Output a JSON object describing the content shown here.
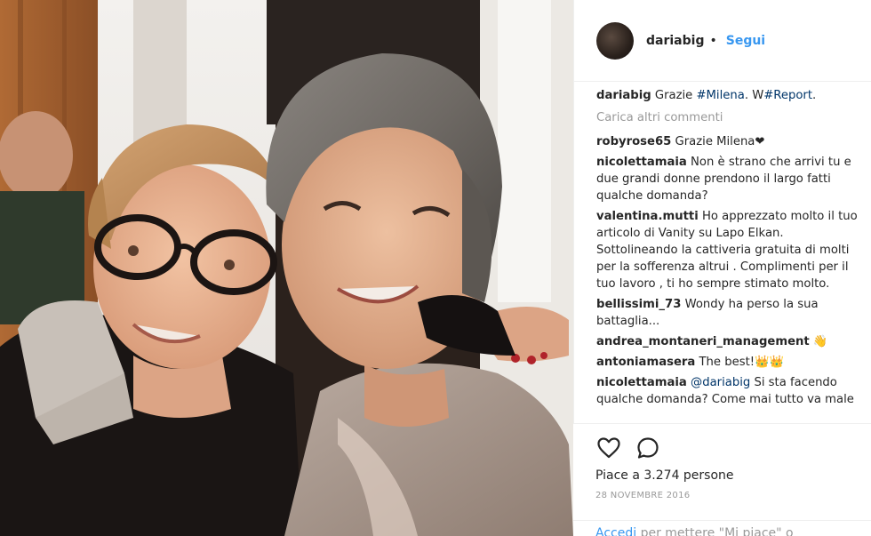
{
  "post": {
    "image_alt": "",
    "author": "dariabig",
    "separator": "•",
    "follow_label": "Segui",
    "caption": {
      "user": "dariabig",
      "text_before": "Grazie ",
      "tag1": "#Milena",
      "text_middle": ". W",
      "tag2": "#Report",
      "text_after": "."
    },
    "load_more_label": "Carica altri commenti",
    "comments": [
      {
        "user": "robyrose65",
        "text": "Grazie Milena❤"
      },
      {
        "user": "nicolettamaia",
        "text": "Non è strano che arrivi tu e due grandi donne prendono il largo fatti qualche domanda?"
      },
      {
        "user": "valentina.mutti",
        "text": "Ho apprezzato molto il tuo articolo di Vanity su Lapo Elkan. Sottolineando la cattiveria gratuita di molti per la sofferenza altrui . Complimenti per il tuo lavoro , ti ho sempre stimato molto."
      },
      {
        "user": "bellissimi_73",
        "text": "Wondy ha perso la sua battaglia..."
      },
      {
        "user": "andrea_montaneri_management",
        "text": "👋"
      },
      {
        "user": "antoniamasera",
        "text": "The best!👑👑"
      }
    ],
    "last_comment": {
      "user": "nicolettamaia",
      "mention": "@dariabig",
      "text": " Si sta facendo qualche domanda? Come mai tutto va male"
    },
    "likes_text": "Piace a 3.274 persone",
    "date": "28 NOVEMBRE 2016",
    "login": {
      "link": "Accedi",
      "text": " per mettere \"Mi piace\" o"
    },
    "icons": {
      "like": "heart-icon",
      "comment": "comment-icon"
    },
    "colors": {
      "link_blue": "#3897f0",
      "hashtag": "#003569",
      "muted": "#999999"
    }
  }
}
